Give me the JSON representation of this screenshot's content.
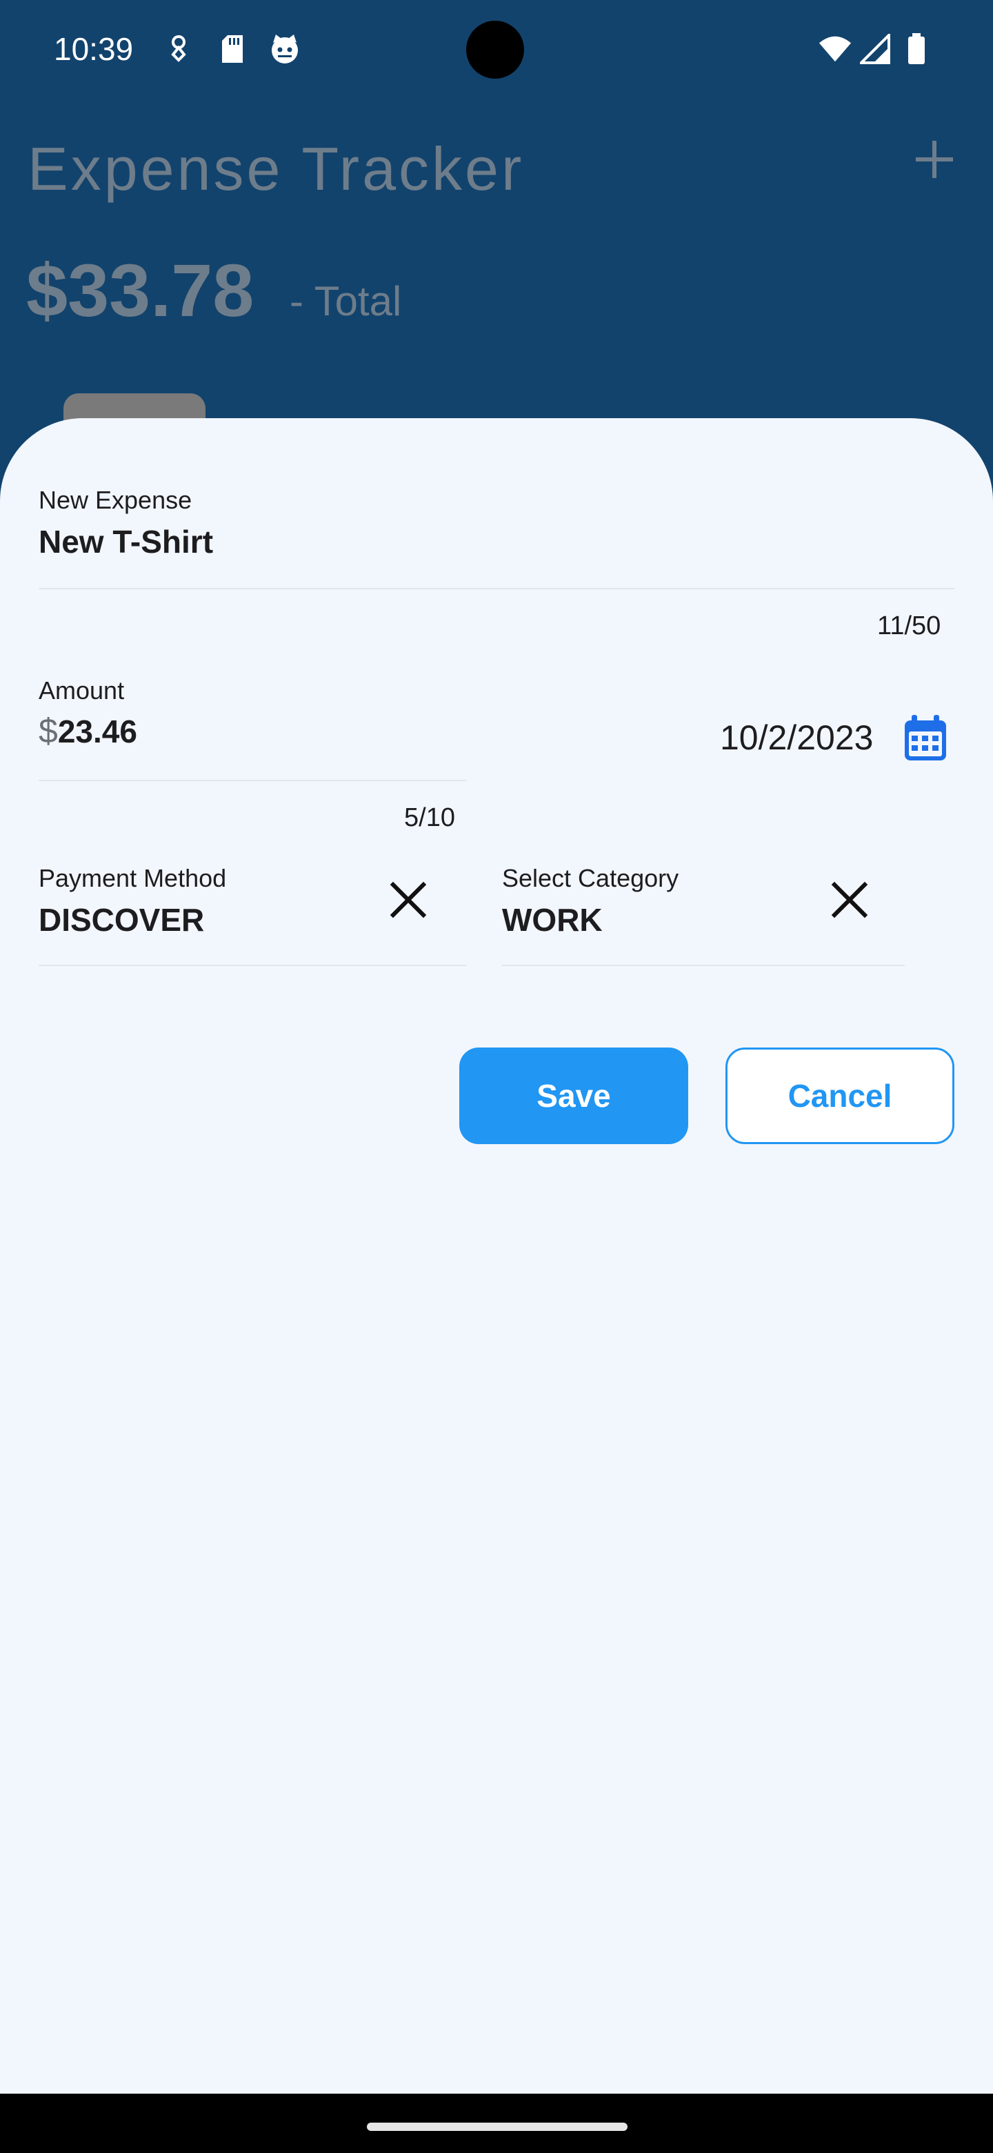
{
  "status_bar": {
    "time": "10:39",
    "icons": [
      "location-icon",
      "sd-card-icon",
      "cat-face-icon",
      "wifi-icon",
      "signal-icon",
      "battery-icon"
    ]
  },
  "background": {
    "title": "Expense Tracker",
    "total_amount": "$33.78",
    "total_label": "- Total",
    "add_icon": "plus-icon"
  },
  "form": {
    "name": {
      "label": "New Expense",
      "value": "New T-Shirt",
      "counter": "11/50"
    },
    "amount": {
      "label": "Amount",
      "currency": "$",
      "value": "23.46",
      "counter": "5/10"
    },
    "date": {
      "value": "10/2/2023",
      "icon": "calendar-icon"
    },
    "payment": {
      "label": "Payment Method",
      "value": "DISCOVER",
      "clear_icon": "close-icon"
    },
    "category": {
      "label": "Select Category",
      "value": "WORK",
      "clear_icon": "close-icon"
    }
  },
  "buttons": {
    "save": "Save",
    "cancel": "Cancel"
  },
  "colors": {
    "header_bg": "#12436d",
    "sheet_bg": "#f2f6fd",
    "accent": "#2196f3",
    "calendar": "#1e6ee8"
  }
}
